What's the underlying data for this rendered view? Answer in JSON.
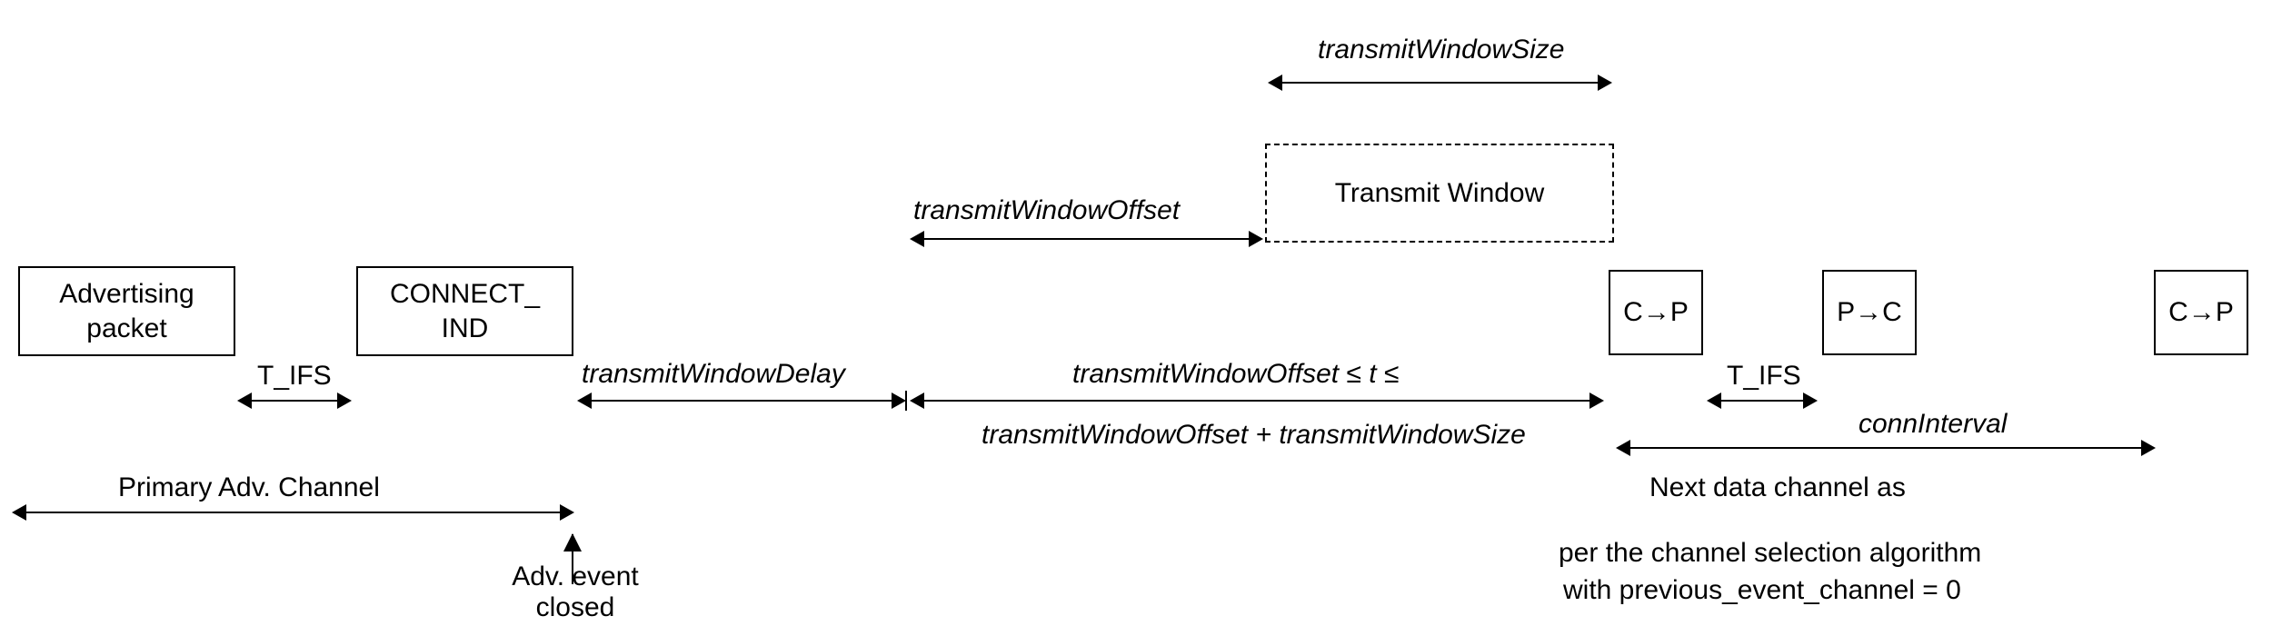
{
  "boxes": {
    "advertising_packet": "Advertising\npacket",
    "connect_ind": "CONNECT_\nIND",
    "transmit_window": "Transmit Window",
    "cp1": "C→P",
    "pc": "P→C",
    "cp2": "C→P"
  },
  "labels": {
    "transmitWindowSize": "transmitWindowSize",
    "transmitWindowOffset": "transmitWindowOffset",
    "t_ifs_1": "T_IFS",
    "t_ifs_2": "T_IFS",
    "transmitWindowDelay": "transmitWindowDelay",
    "inequality_top": "transmitWindowOffset ≤ t ≤",
    "inequality_bottom": "transmitWindowOffset + transmitWindowSize",
    "primary_adv_channel": "Primary Adv. Channel",
    "adv_event_closed": "Adv.  event\nclosed",
    "connInterval": "connInterval",
    "next_data_channel": "Next data channel as",
    "per_channel_sel_1": "per the channel selection algorithm",
    "per_channel_sel_2": "with previous_event_channel = 0"
  }
}
